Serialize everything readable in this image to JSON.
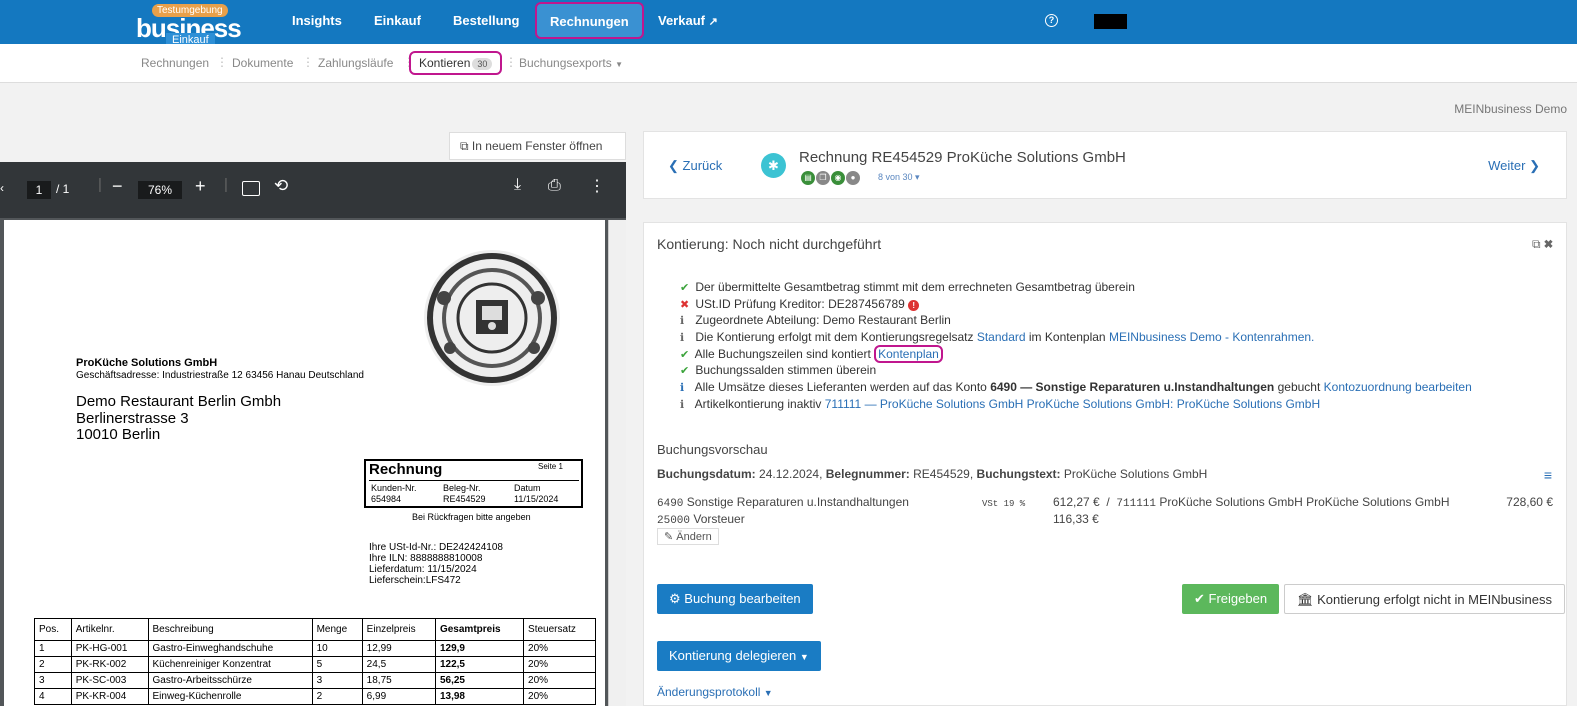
{
  "topnav": {
    "testing_badge": "Testumgebung",
    "logo_word": "business",
    "logo_sub": "Einkauf",
    "items": [
      "Insights",
      "Einkauf",
      "Bestellung",
      "Rechnungen",
      "Verkauf"
    ],
    "help_icon": "question-circle-icon",
    "accent": "#1478c0"
  },
  "subnav": {
    "items": [
      "Rechnungen",
      "Dokumente",
      "Zahlungsläufe",
      "Kontieren",
      "Buchungsexports"
    ],
    "kontieren_count": "30"
  },
  "tenant": "MEINbusiness Demo",
  "open_new": "In neuem Fenster öffnen",
  "viewer": {
    "page": "1",
    "pages": "/ 1",
    "zoom": "76%"
  },
  "doc": {
    "sender": "ProKüche Solutions GmbH",
    "sender_addr": "Geschäftsadresse: Industriestraße 12 63456 Hanau Deutschland",
    "recipient": [
      "Demo Restaurant Berlin Gmbh",
      "Berlinerstrasse 3",
      "10010 Berlin"
    ],
    "box_title": "Rechnung",
    "box_page": "Seite 1",
    "box_labels": [
      "Kunden-Nr.",
      "Beleg-Nr.",
      "Datum"
    ],
    "box_values": [
      "654984",
      "RE454529",
      "11/15/2024"
    ],
    "note": "Bei Rückfragen bitte angeben",
    "info": [
      "Ihre USt-Id-Nr.: DE242424108",
      "Ihre ILN: 8888888810008",
      "Lieferdatum: 11/15/2024",
      "Lieferschein:LFS472"
    ],
    "headers": [
      "Pos.",
      "Artikelnr.",
      "Beschreibung",
      "Menge",
      "Einzelpreis",
      "Gesamtpreis",
      "Steuersatz"
    ],
    "rows": [
      [
        "1",
        "PK-HG-001",
        "Gastro-Einweghandschuhe",
        "10",
        "12,99",
        "129,9",
        "20%"
      ],
      [
        "2",
        "PK-RK-002",
        "Küchenreiniger Konzentrat",
        "5",
        "24,5",
        "122,5",
        "20%"
      ],
      [
        "3",
        "PK-SC-003",
        "Gastro-Arbeitsschürze",
        "3",
        "18,75",
        "56,25",
        "20%"
      ],
      [
        "4",
        "PK-KR-004",
        "Einweg-Küchenrolle",
        "2",
        "6,99",
        "13,98",
        "20%"
      ]
    ]
  },
  "invoice": {
    "back": "Zurück",
    "next": "Weiter",
    "title": "Rechnung RE454529 ProKüche Solutions GmbH",
    "count": "8 von 30"
  },
  "kont": {
    "title": "Kontierung: Noch nicht durchgeführt",
    "c1": "Der übermittelte Gesamtbetrag stimmt mit dem errechneten Gesamtbetrag überein",
    "c2": "USt.ID Prüfung Kreditor: DE287456789",
    "c3": "Zugeordnete Abteilung: Demo Restaurant Berlin",
    "c4a": "Die Kontierung erfolgt mit dem Kontierungsregelsatz",
    "c4b": "Standard",
    "c4c": "im Kontenplan",
    "c4d": "MEINbusiness Demo - Kontenrahmen.",
    "c5a": "Alle Buchungszeilen sind kontiert",
    "c5b": "Kontenplan",
    "c6": "Buchungssalden stimmen überein",
    "c7a": "Alle Umsätze dieses Lieferanten werden auf das Konto",
    "c7b": "6490 — Sonstige Reparaturen u.Instandhaltungen",
    "c7c": "gebucht",
    "c7d": "Kontozuordnung bearbeiten",
    "c8a": "Artikelkontierung inaktiv",
    "c8b": "711111 — ProKüche Solutions GmbH ProKüche Solutions GmbH: ProKüche Solutions GmbH"
  },
  "preview": {
    "title": "Buchungsvorschau",
    "l_date": "Buchungsdatum:",
    "date": "24.12.2024,",
    "l_beleg": "Belegnummer:",
    "beleg": "RE454529,",
    "l_text": "Buchungstext:",
    "text": "ProKüche Solutions GmbH",
    "r1_acc": "6490",
    "r1_name": "Sonstige Reparaturen u.Instandhaltungen",
    "r1_tax": "VSt 19 %",
    "r1_amt": "612,27 €",
    "slash": "/",
    "r1_cred": "711111",
    "r1_credname": "ProKüche Solutions GmbH ProKüche Solutions GmbH",
    "r1_total": "728,60 €",
    "r2_acc": "25000",
    "r2_name": "Vorsteuer",
    "r2_amt": "116,33 €",
    "edit": "Ändern"
  },
  "buttons": {
    "edit": "Buchung bearbeiten",
    "approve": "Freigeben",
    "external": "Kontierung erfolgt nicht in MEINbusiness",
    "delegate": "Kontierung delegieren",
    "log": "Änderungsprotokoll"
  }
}
